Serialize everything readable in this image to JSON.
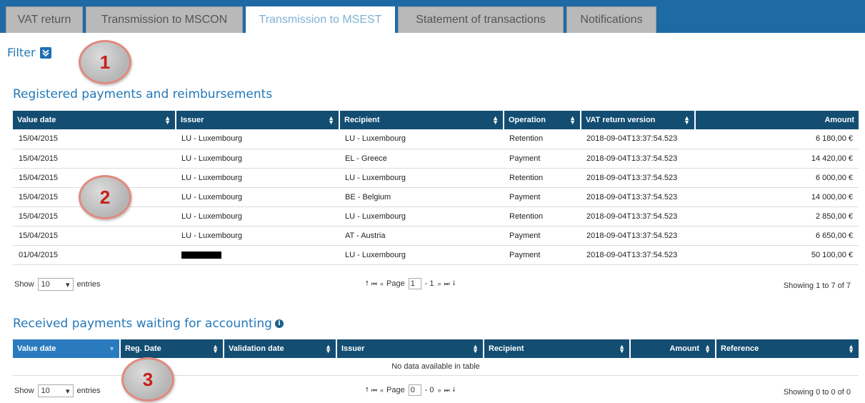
{
  "tabs": [
    {
      "label": "VAT return",
      "active": false
    },
    {
      "label": "Transmission to MSCON",
      "active": false
    },
    {
      "label": "Transmission to MSEST",
      "active": true
    },
    {
      "label": "Statement of transactions",
      "active": false
    },
    {
      "label": "Notifications",
      "active": false
    }
  ],
  "filter": {
    "label": "Filter",
    "icon": "chevron-double-down-icon"
  },
  "registered": {
    "title": "Registered payments and reimbursements",
    "columns": [
      "Value date",
      "Issuer",
      "Recipient",
      "Operation",
      "VAT return version",
      "Amount"
    ],
    "rows": [
      [
        "15/04/2015",
        "LU - Luxembourg",
        "LU - Luxembourg",
        "Retention",
        "2018-09-04T13:37:54.523",
        "6 180,00 €"
      ],
      [
        "15/04/2015",
        "LU - Luxembourg",
        "EL - Greece",
        "Payment",
        "2018-09-04T13:37:54.523",
        "14 420,00 €"
      ],
      [
        "15/04/2015",
        "LU - Luxembourg",
        "LU - Luxembourg",
        "Retention",
        "2018-09-04T13:37:54.523",
        "6 000,00 €"
      ],
      [
        "15/04/2015",
        "LU - Luxembourg",
        "BE - Belgium",
        "Payment",
        "2018-09-04T13:37:54.523",
        "14 000,00 €"
      ],
      [
        "15/04/2015",
        "LU - Luxembourg",
        "LU - Luxembourg",
        "Retention",
        "2018-09-04T13:37:54.523",
        "2 850,00 €"
      ],
      [
        "15/04/2015",
        "LU - Luxembourg",
        "AT - Austria",
        "Payment",
        "2018-09-04T13:37:54.523",
        "6 650,00 €"
      ],
      [
        "01/04/2015",
        "",
        "LU - Luxembourg",
        "Payment",
        "2018-09-04T13:37:54.523",
        "50 100,00 €"
      ]
    ],
    "show_label": "Show",
    "entries_value": "10",
    "entries_label": "entries",
    "page_label": "Page",
    "page_value": "1",
    "page_total": "- 1",
    "showing": "Showing 1 to 7 of 7"
  },
  "received": {
    "title": "Received payments waiting for accounting",
    "columns": [
      "Value date",
      "Reg. Date",
      "Validation date",
      "Issuer",
      "Recipient",
      "Amount",
      "Reference"
    ],
    "empty": "No data available in table",
    "show_label": "Show",
    "entries_value": "10",
    "entries_label": "entries",
    "page_label": "Page",
    "page_value": "0",
    "page_total": "- 0",
    "showing": "Showing 0 to 0 of 0"
  },
  "callouts": [
    "1",
    "2",
    "3"
  ],
  "colors": {
    "tabbar": "#1e6aa5",
    "header": "#134d72",
    "title": "#2478b8",
    "callout_text": "#c8201a"
  }
}
